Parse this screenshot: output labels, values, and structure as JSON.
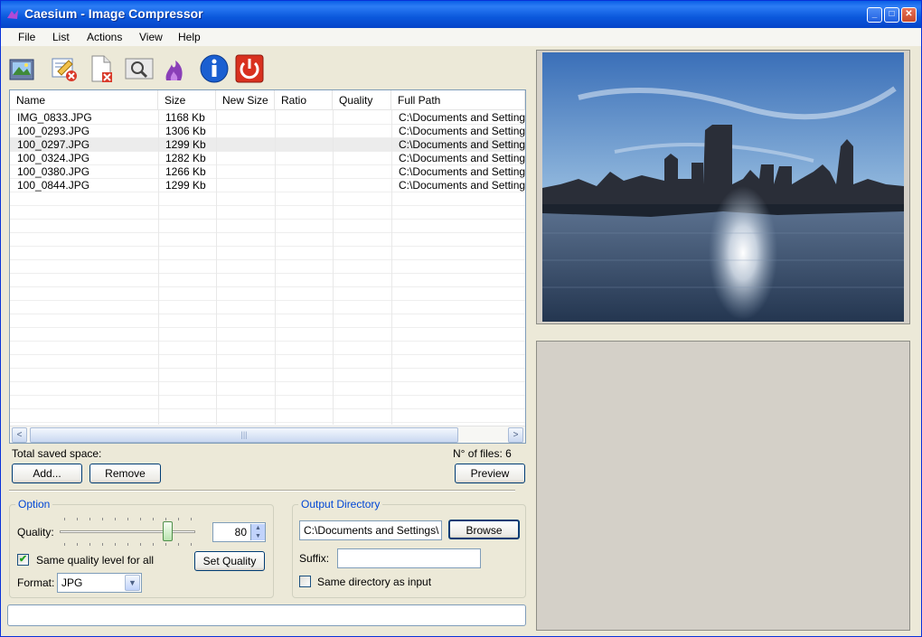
{
  "window": {
    "title": "Caesium - Image Compressor"
  },
  "menu": [
    "File",
    "List",
    "Actions",
    "View",
    "Help"
  ],
  "toolbar_icons": [
    "open-images-icon",
    "clear-list-icon",
    "remove-file-icon",
    "preview-icon",
    "compress-icon",
    "info-icon",
    "exit-icon"
  ],
  "columns": [
    "Name",
    "Size",
    "New Size",
    "Ratio",
    "Quality",
    "Full Path"
  ],
  "files": [
    {
      "name": "IMG_0833.JPG",
      "size": "1168 Kb",
      "new_size": "",
      "ratio": "",
      "quality": "",
      "path": "C:\\Documents and Settings\\"
    },
    {
      "name": "100_0293.JPG",
      "size": "1306 Kb",
      "new_size": "",
      "ratio": "",
      "quality": "",
      "path": "C:\\Documents and Settings\\"
    },
    {
      "name": "100_0297.JPG",
      "size": "1299 Kb",
      "new_size": "",
      "ratio": "",
      "quality": "",
      "path": "C:\\Documents and Settings\\"
    },
    {
      "name": "100_0324.JPG",
      "size": "1282 Kb",
      "new_size": "",
      "ratio": "",
      "quality": "",
      "path": "C:\\Documents and Settings\\"
    },
    {
      "name": "100_0380.JPG",
      "size": "1266 Kb",
      "new_size": "",
      "ratio": "",
      "quality": "",
      "path": "C:\\Documents and Settings\\"
    },
    {
      "name": "100_0844.JPG",
      "size": "1299 Kb",
      "new_size": "",
      "ratio": "",
      "quality": "",
      "path": "C:\\Documents and Settings\\"
    }
  ],
  "selected_row": 2,
  "summary": {
    "saved_label": "Total saved space:",
    "files_label": "N° of files: 6"
  },
  "buttons": {
    "add": "Add...",
    "remove": "Remove",
    "preview": "Preview",
    "set_quality": "Set Quality",
    "browse": "Browse"
  },
  "option": {
    "title": "Option",
    "quality_label": "Quality:",
    "quality_value": "80",
    "quality_fraction": 0.8,
    "same_quality_label": "Same quality level for all",
    "same_quality_checked": true,
    "format_label": "Format:",
    "format_value": "JPG"
  },
  "output": {
    "title": "Output Directory",
    "directory_value": "C:\\Documents and Settings\\",
    "suffix_label": "Suffix:",
    "suffix_value": "",
    "same_dir_label": "Same directory as input",
    "same_dir_checked": false
  },
  "colors": {
    "title_bar": "#0a5ee6",
    "group_title": "#0046d5",
    "preview_bg": "#d4d0c8"
  }
}
